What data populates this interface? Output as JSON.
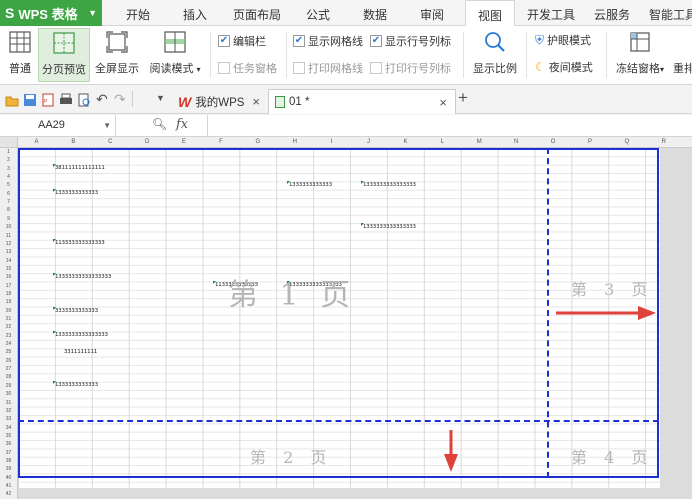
{
  "app": {
    "title": "WPS 表格"
  },
  "menu": {
    "tabs": [
      "开始",
      "插入",
      "页面布局",
      "公式",
      "数据",
      "审阅",
      "视图",
      "开发工具",
      "云服务",
      "智能工具"
    ],
    "active": "视图"
  },
  "ribbon": {
    "normal": "普通",
    "page_break_preview": "分页预览",
    "full_screen": "全屏显示",
    "reading_mode": "阅读模式",
    "edit_bar": "编辑栏",
    "task_pane": "任务窗格",
    "show_gridlines": "显示网格线",
    "show_headings": "显示行号列标",
    "print_gridlines": "打印网格线",
    "print_headings": "打印行号列标",
    "zoom": "显示比例",
    "eye_protection": "护眼模式",
    "night_mode": "夜间模式",
    "freeze_panes": "冻结窗格",
    "rearrange": "重排"
  },
  "doc_tabs": [
    {
      "label": "我的WPS"
    },
    {
      "label": "01 *"
    }
  ],
  "formula_bar": {
    "cell_ref": "AA29",
    "fx": "fx"
  },
  "sheet": {
    "columns": [
      "A",
      "B",
      "C",
      "D",
      "E",
      "F",
      "G",
      "H",
      "I",
      "J",
      "K",
      "L",
      "M",
      "N",
      "O",
      "P",
      "Q",
      "R"
    ],
    "cells": {
      "b3": "381111111111111",
      "b6": "1333333333333",
      "h5": "1333333333333",
      "j5": "1333333333333333",
      "j10": "1333333333333333",
      "b12": "113333333333333",
      "b16": "13333333333333333",
      "e17": "1133333333333",
      "h17": "1333333333333333",
      "b20": "3333333333333",
      "b23": "1333333333333333",
      "b26": "3311111111",
      "b29": "1333333333333"
    },
    "page_labels": {
      "page1": "第 1 页",
      "page2": "第 2 页",
      "page3": "第 3 页",
      "page4": "第 4 页"
    },
    "accent": "#1c2fd1",
    "arrow_color": "#e0413a"
  }
}
